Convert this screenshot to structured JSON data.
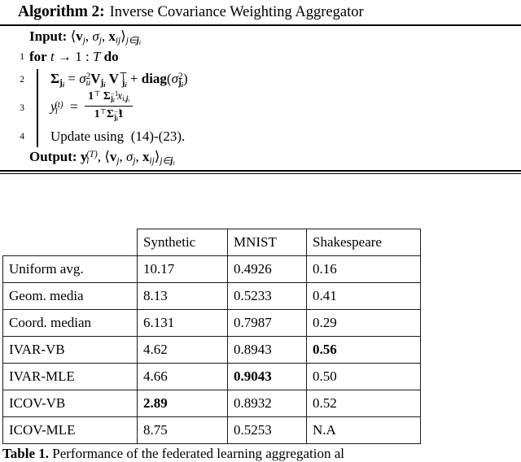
{
  "algorithm": {
    "title_label": "Algorithm 2:",
    "title_text": "Inverse Covariance Weighting Aggregator",
    "input_label": "Input:",
    "input_expr": "⟨v_j, σ_j, x_ij⟩_{j∈j_i}",
    "lines": [
      {
        "no": "1",
        "text": "for t → 1 : T do"
      },
      {
        "no": "2",
        "text": "Σ_{j_i} = σ²_u V_{j_i} V^⊤_{j_i} + diag(σ²_{j_i})"
      },
      {
        "no": "3",
        "text": "y_i^{(t)} = (1^⊤ Σ^{-1}_{j_i} x_{i,j_i}) / (1^⊤ Σ^{-1}_{j_i} 1)"
      },
      {
        "no": "4",
        "text": "Update using  (14)-(23)."
      }
    ],
    "update_text_pre": "Update using",
    "update_text_refs": "(14)-(23).",
    "output_label": "Output:",
    "output_expr": "y_i^{(T)}, ⟨v_j, σ_j, x_ij⟩_{j∈j_i}",
    "symbols": {
      "for": "for",
      "do": "do",
      "t": "t",
      "arrow": "→",
      "colon": ":",
      "T": "T",
      "Sigma": "Σ",
      "equals": "=",
      "sigma": "σ",
      "V": "V",
      "transpose": "⊤",
      "plus": "+",
      "diag": "diag",
      "y": "y",
      "one": "1",
      "x": "x",
      "v": "v",
      "j": "j",
      "i": "i",
      "u": "u",
      "2": "2",
      "minus1": "−1",
      "angle_open": "⟨",
      "angle_close": "⟩",
      "in": "∈",
      "comma": ","
    }
  },
  "table": {
    "columns": [
      "",
      "Synthetic",
      "MNIST",
      "Shakespeare"
    ],
    "rows": [
      {
        "method": "Uniform avg.",
        "synthetic": "10.17",
        "mnist": "0.4926",
        "shakespeare": "0.16",
        "bold": {
          "synthetic": false,
          "mnist": false,
          "shakespeare": false
        }
      },
      {
        "method": "Geom. media",
        "synthetic": "8.13",
        "mnist": "0.5233",
        "shakespeare": "0.41",
        "bold": {
          "synthetic": false,
          "mnist": false,
          "shakespeare": false
        }
      },
      {
        "method": "Coord. median",
        "synthetic": "6.131",
        "mnist": "0.7987",
        "shakespeare": "0.29",
        "bold": {
          "synthetic": false,
          "mnist": false,
          "shakespeare": false
        }
      },
      {
        "method": "IVAR-VB",
        "synthetic": "4.62",
        "mnist": "0.8943",
        "shakespeare": "0.56",
        "bold": {
          "synthetic": false,
          "mnist": false,
          "shakespeare": true
        }
      },
      {
        "method": "IVAR-MLE",
        "synthetic": "4.66",
        "mnist": "0.9043",
        "shakespeare": "0.50",
        "bold": {
          "synthetic": false,
          "mnist": true,
          "shakespeare": false
        }
      },
      {
        "method": "ICOV-VB",
        "synthetic": "2.89",
        "mnist": "0.8932",
        "shakespeare": "0.52",
        "bold": {
          "synthetic": true,
          "mnist": false,
          "shakespeare": false
        }
      },
      {
        "method": "ICOV-MLE",
        "synthetic": "8.75",
        "mnist": "0.5253",
        "shakespeare": "N.A",
        "bold": {
          "synthetic": false,
          "mnist": false,
          "shakespeare": false
        }
      }
    ]
  },
  "caption": {
    "label": "Table 1.",
    "text": "Performance of the federated learning aggregation al"
  }
}
